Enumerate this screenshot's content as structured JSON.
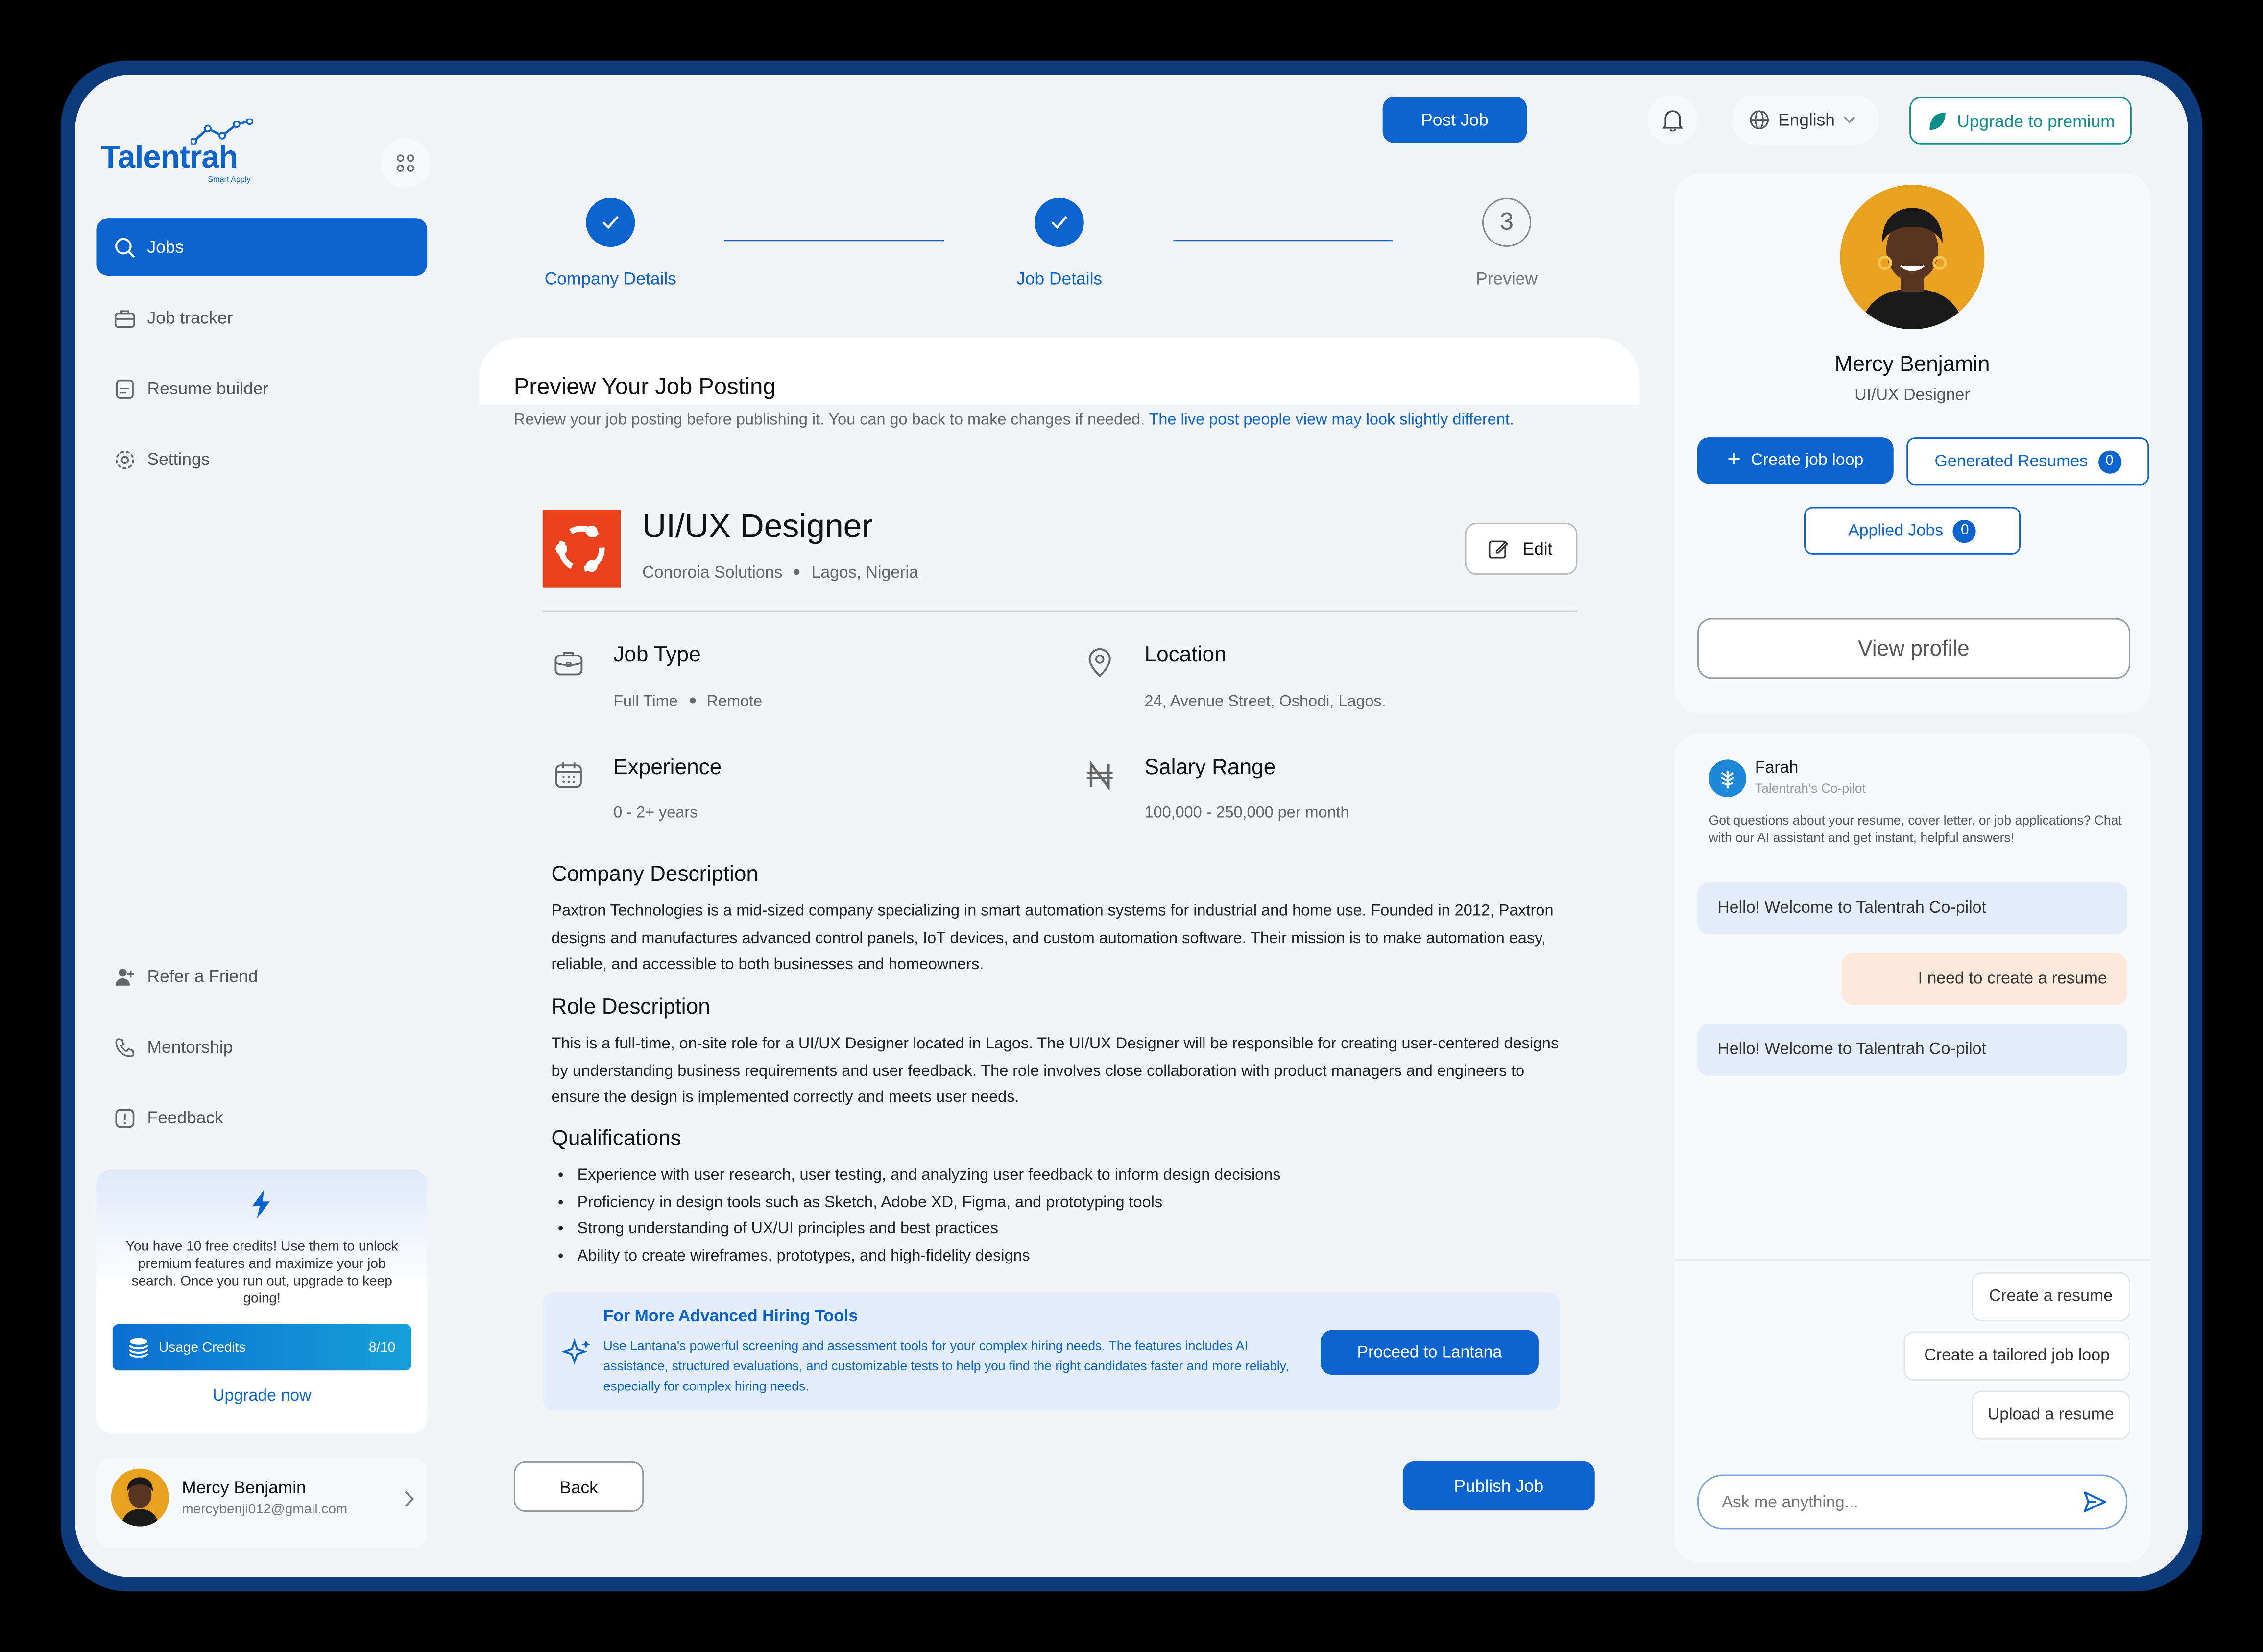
{
  "app": {
    "logo": "Talentrah",
    "logo_sub": "Smart Apply"
  },
  "sidebar": {
    "items": [
      {
        "label": "Jobs",
        "icon": "search-icon"
      },
      {
        "label": "Job tracker",
        "icon": "briefcase-icon"
      },
      {
        "label": "Resume builder",
        "icon": "document-icon"
      },
      {
        "label": "Settings",
        "icon": "gear-icon"
      }
    ],
    "bottom_items": [
      {
        "label": "Refer a Friend",
        "icon": "user-plus-icon"
      },
      {
        "label": "Mentorship",
        "icon": "phone-icon"
      },
      {
        "label": "Feedback",
        "icon": "feedback-icon"
      }
    ],
    "credits": {
      "text": "You have 10 free credits! Use them to unlock premium features and maximize your job search. Once you run out, upgrade to keep going!",
      "usage_label": "Usage Credits",
      "usage_value": "8/10",
      "upgrade": "Upgrade now"
    },
    "user": {
      "name": "Mercy Benjamin",
      "email": "mercybenji012@gmail.com"
    }
  },
  "header": {
    "post_job": "Post Job",
    "language": "English",
    "upgrade": "Upgrade to premium"
  },
  "steps": [
    {
      "label": "Company Details",
      "state": "done"
    },
    {
      "label": "Job Details",
      "state": "done"
    },
    {
      "label": "Preview",
      "number": "3",
      "state": "current"
    }
  ],
  "preview": {
    "title": "Preview Your Job Posting",
    "subtitle": "Review your job posting before publishing it. You can go back to make changes if needed.",
    "subtitle_link": "The live post people view may look slightly different.",
    "job": {
      "title": "UI/UX Designer",
      "company": "Conoroia Solutions",
      "location": "Lagos, Nigeria",
      "edit": "Edit"
    },
    "details": {
      "job_type": {
        "label": "Job Type",
        "value1": "Full Time",
        "value2": "Remote"
      },
      "location": {
        "label": "Location",
        "value": "24, Avenue Street, Oshodi, Lagos."
      },
      "experience": {
        "label": "Experience",
        "value": "0 - 2+ years"
      },
      "salary": {
        "label": "Salary Range",
        "value": "100,000 - 250,000 per month"
      }
    },
    "company_description": {
      "heading": "Company Description",
      "text": "Paxtron Technologies is a mid-sized company specializing in smart automation systems for industrial and home use. Founded in 2012, Paxtron designs and manufactures advanced control panels, IoT devices, and custom automation software. Their mission is to make automation easy, reliable, and accessible to both businesses and homeowners."
    },
    "role_description": {
      "heading": "Role Description",
      "text": "This is a full-time, on-site role for a UI/UX Designer located in Lagos. The UI/UX Designer will be responsible for creating user-centered designs by understanding business requirements and user feedback. The role involves close collaboration with product managers and engineers to ensure the design is implemented correctly and meets user needs."
    },
    "qualifications": {
      "heading": "Qualifications",
      "items": [
        "Experience with user research, user testing, and analyzing user feedback to inform design decisions",
        "Proficiency in design tools such as Sketch, Adobe XD, Figma, and prototyping tools",
        "Strong understanding of UX/UI principles and best practices",
        "Ability to create wireframes, prototypes, and high-fidelity designs"
      ]
    },
    "tools": {
      "title": "For More Advanced Hiring Tools",
      "text": "Use Lantana's powerful screening and assessment tools for your complex hiring needs. The features includes AI assistance, structured evaluations, and customizable tests to help you find the right candidates faster and more reliably, especially for complex hiring needs.",
      "button": "Proceed to Lantana"
    },
    "back": "Back",
    "publish": "Publish Job"
  },
  "profile": {
    "name": "Mercy Benjamin",
    "role": "UI/UX Designer",
    "create_loop": "Create job loop",
    "generated_resumes": "Generated Resumes",
    "generated_count": "0",
    "applied_jobs": "Applied Jobs",
    "applied_count": "0",
    "view_profile": "View profile"
  },
  "chat": {
    "bot_name": "Farah",
    "bot_sub": "Talentrah's Co-pilot",
    "intro": "Got questions about your resume, cover letter, or job applications? Chat with our AI assistant and get instant, helpful answers!",
    "messages": [
      {
        "from": "bot",
        "text": "Hello! Welcome to Talentrah Co-pilot"
      },
      {
        "from": "user",
        "text": "I need to create a resume"
      },
      {
        "from": "bot",
        "text": "Hello! Welcome to Talentrah Co-pilot"
      }
    ],
    "suggestions": [
      "Create a resume",
      "Create a tailored job loop",
      "Upload a resume"
    ],
    "input_placeholder": "Ask me anything..."
  },
  "colors": {
    "primary": "#0b63ce",
    "teal": "#0c8d8a",
    "frame": "#0d3a7a",
    "company_logo": "#e8411b"
  }
}
